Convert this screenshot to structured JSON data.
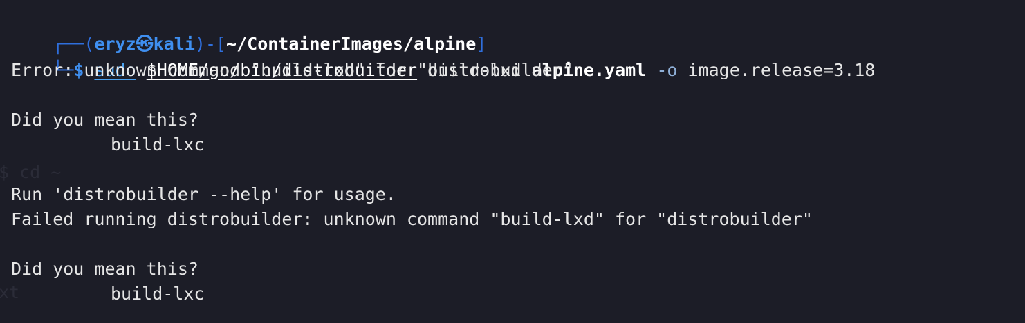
{
  "prompt": {
    "top_left": "┌──(",
    "user": "eryz",
    "at_symbol": "㉿",
    "host": "kali",
    "mid": ")-[",
    "path": "~/ContainerImages/alpine",
    "end": "]",
    "bottom_left": "└─",
    "dollar": "$"
  },
  "command": {
    "sudo": "sudo",
    "binary": "$HOME/go/bin/distrobuilder",
    "subcommand": "build-lxd",
    "file": "alpine.yaml",
    "flag": "-o",
    "option": "image.release=3.18"
  },
  "output": {
    "error_line": "Error: unknown command \"build-lxd\" for \"distrobuilder\"",
    "suggest_header_1": "Did you mean this?",
    "suggestion_1": "build-lxc",
    "help_line": "Run 'distrobuilder --help' for usage.",
    "failed_line": "Failed running distrobuilder: unknown command \"build-lxd\" for \"distrobuilder\"",
    "suggest_header_2": "Did you mean this?",
    "suggestion_2": "build-lxc"
  },
  "colors": {
    "background": "#1c1d27",
    "prompt_blue": "#3f8ff0",
    "text": "#e6e6e6"
  }
}
